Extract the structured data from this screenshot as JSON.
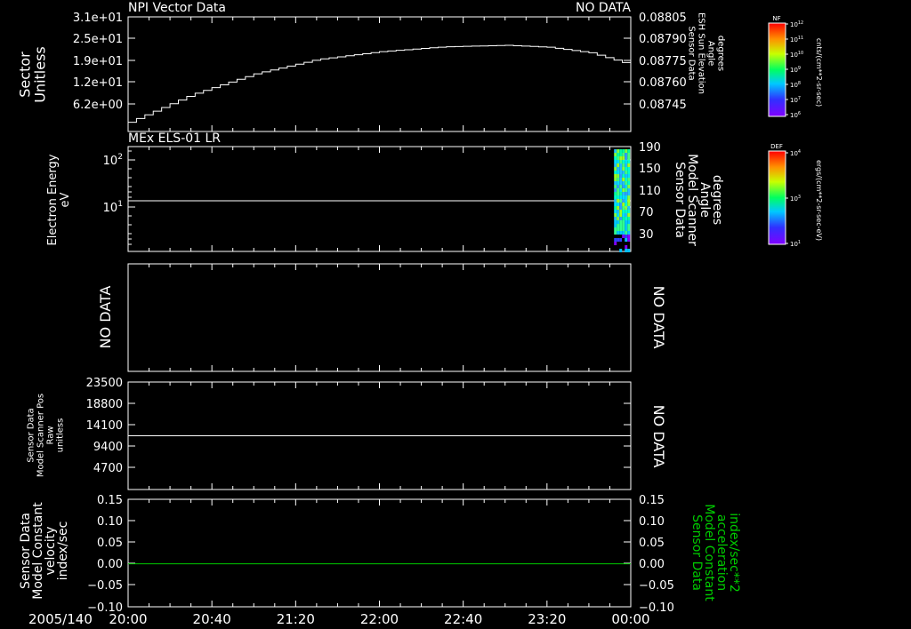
{
  "chart_data": {
    "date_label": "2005/140",
    "time_ticks": [
      "20:00",
      "20:40",
      "21:20",
      "22:00",
      "22:40",
      "23:20",
      "00:00"
    ],
    "panels": [
      {
        "type": "line",
        "title": "NPI Vector Data",
        "right_title": "NO DATA",
        "ylabel": [
          "Sector",
          "Unitless"
        ],
        "y_ticks": [
          "3.1e+01",
          "2.5e+01",
          "1.9e+01",
          "1.2e+01",
          "6.2e+00"
        ],
        "ylim": [
          0,
          31
        ],
        "right_ticks": [
          "0.08805",
          "0.08790",
          "0.08775",
          "0.08760",
          "0.08745"
        ],
        "right_label": [
          "Sensor Data",
          "ESH Sun Elevation",
          "Angle",
          "degrees"
        ],
        "series": [
          {
            "x_hours": [
              0.0,
              0.5,
              1.0,
              1.5,
              2.0,
              2.5,
              3.0,
              3.333,
              3.667,
              4.0
            ],
            "y": [
              2.5,
              10.0,
              15.6,
              19.5,
              21.6,
              22.9,
              23.3,
              22.8,
              21.3,
              18.0
            ]
          }
        ]
      },
      {
        "type": "heatmap",
        "title": "MEx ELS-01 LR",
        "ylabel": [
          "Electron Energy",
          "eV"
        ],
        "y_ticks": [
          "10^2",
          "10^1"
        ],
        "right_ticks": [
          "190",
          "150",
          "110",
          "70",
          "30"
        ],
        "right_label": [
          "Sensor Data",
          "Model Scanner",
          "Angle",
          "degrees"
        ],
        "line_value_log10": 1.17,
        "heatmap_x_hours": [
          3.867,
          4.0
        ]
      },
      {
        "type": "empty",
        "left_text": "NO DATA",
        "right_text": "NO DATA"
      },
      {
        "type": "line",
        "ylabel": [
          "Sensor Data",
          "Model Scanner Pos",
          "Raw",
          "unitless"
        ],
        "y_ticks": [
          "23500",
          "18800",
          "14100",
          "9400",
          "4700"
        ],
        "ylim": [
          0,
          23500
        ],
        "right_text": "NO DATA",
        "line_value": 11750
      },
      {
        "type": "line",
        "ylabel": [
          "Sensor Data",
          "Model Constant",
          "velocity",
          "index/sec"
        ],
        "y_ticks": [
          "0.15",
          "0.10",
          "0.05",
          "0.00",
          "−0.05",
          "−0.10"
        ],
        "ylim": [
          -0.1,
          0.15
        ],
        "right_ticks": [
          "0.15",
          "0.10",
          "0.05",
          "0.00",
          "−0.05",
          "−0.10"
        ],
        "right_label": [
          "Sensor Data",
          "Model Constant",
          "acceleration",
          "index/sec**2"
        ],
        "line_value": 0.0,
        "line_color": "#00cc00",
        "right_label_color": "#00cc00"
      }
    ],
    "colorbars": [
      {
        "label": "NF",
        "ticks": [
          "10^12",
          "10^11",
          "10^10",
          "10^9",
          "10^8",
          "10^7",
          "10^6"
        ],
        "units": "cnts/(cm**2-sr-sec)"
      },
      {
        "label": "DEF",
        "ticks": [
          "10^4",
          "10^3",
          "10^2",
          "10^1"
        ],
        "units": "ergs/(cm**2-sr-sec-eV)"
      }
    ]
  }
}
